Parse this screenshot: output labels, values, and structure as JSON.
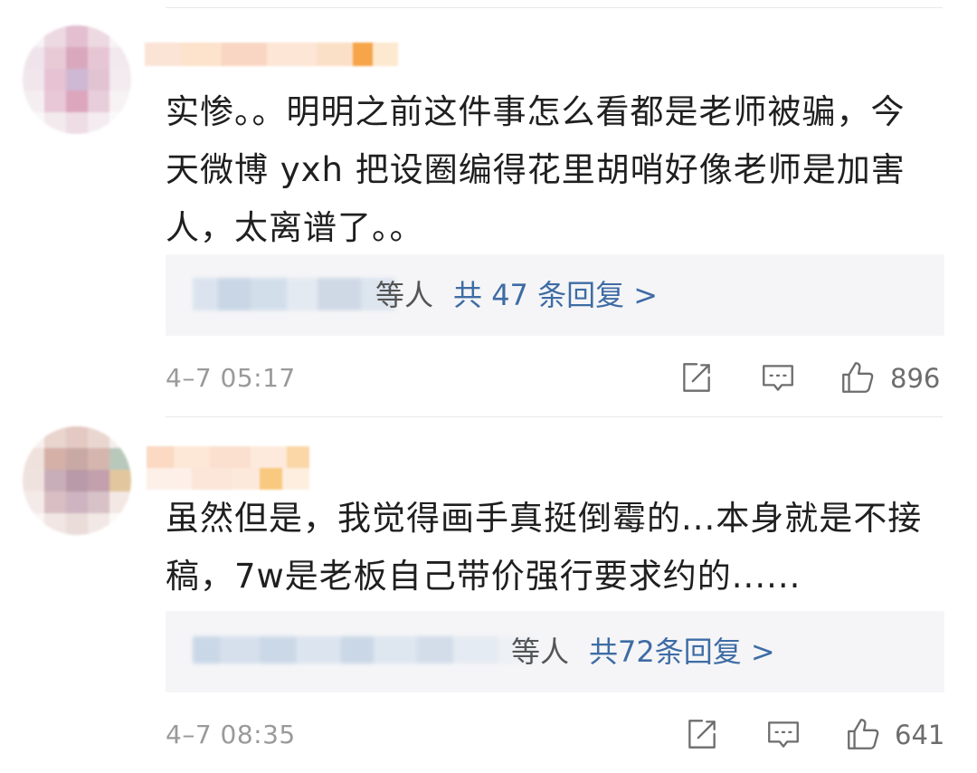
{
  "comments": [
    {
      "text": "实惨。。明明之前这件事怎么看都是老师被骗，今天微博 yxh 把设圈编得花里胡哨好像老师是加害人，太离谱了。。",
      "reply_people": "等人",
      "reply_link": "共 47 条回复 >",
      "timestamp": "4–7 05:17",
      "likes": "896"
    },
    {
      "text": "虽然但是，我觉得画手真挺倒霉的...本身就是不接稿，7w是老板自己带价强行要求约的......",
      "reply_people": "等人",
      "reply_link": "共72条回复 >",
      "timestamp": "4–7 08:35",
      "likes": "641"
    }
  ],
  "icons": {
    "share": "share-icon",
    "comment": "comment-icon",
    "like": "like-icon"
  },
  "colors": {
    "link": "#3e6ca4",
    "reply_bg": "#f5f5f7",
    "meta": "#9a9a9a"
  }
}
